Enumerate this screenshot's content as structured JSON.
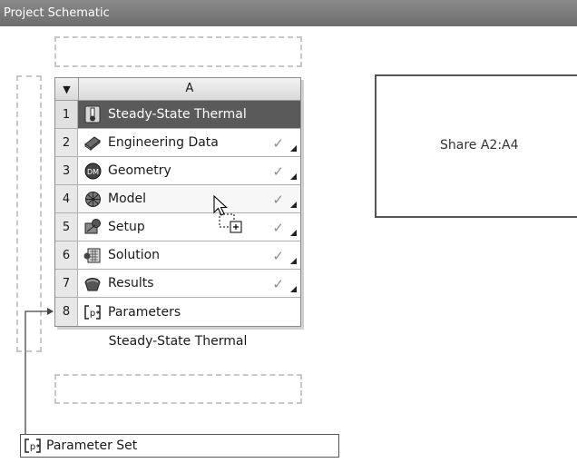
{
  "window": {
    "title": "Project Schematic"
  },
  "system": {
    "column_header": "A",
    "name": "Steady-State Thermal",
    "rows": [
      {
        "num": "1",
        "label": "Steady-State Thermal",
        "icon": "thermometer-icon"
      },
      {
        "num": "2",
        "label": "Engineering Data",
        "icon": "engineering-data-icon",
        "status": "✓"
      },
      {
        "num": "3",
        "label": "Geometry",
        "icon": "geometry-dm-icon",
        "status": "✓"
      },
      {
        "num": "4",
        "label": "Model",
        "icon": "model-mesh-icon",
        "status": "✓"
      },
      {
        "num": "5",
        "label": "Setup",
        "icon": "setup-icon",
        "status": "✓"
      },
      {
        "num": "6",
        "label": "Solution",
        "icon": "solution-icon",
        "status": "✓"
      },
      {
        "num": "7",
        "label": "Results",
        "icon": "results-icon",
        "status": "✓"
      },
      {
        "num": "8",
        "label": "Parameters",
        "icon": "parameters-icon"
      }
    ]
  },
  "drop_target": {
    "label": "Share A2:A4"
  },
  "parameter_set": {
    "label": "Parameter Set",
    "icon": "parameters-icon"
  },
  "cursor": {
    "icon": "drag-copy-cursor-icon"
  },
  "colors": {
    "titlebar": "#7a7a7a",
    "system_title_row": "#5a5a5a"
  }
}
